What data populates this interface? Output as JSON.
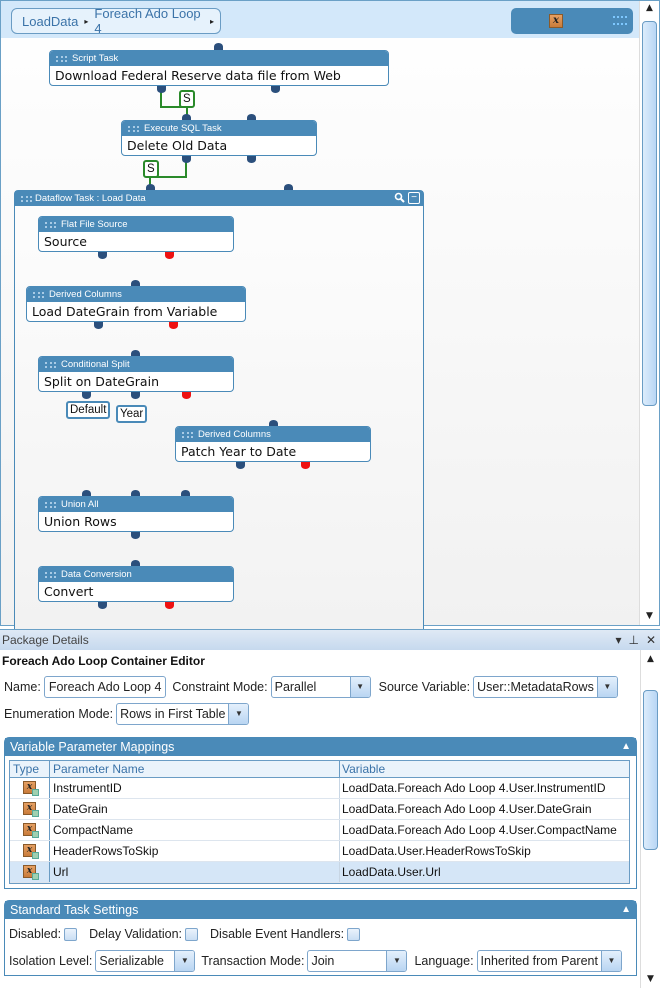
{
  "designer": {
    "breadcrumb": [
      {
        "label": "LoadData"
      },
      {
        "label": "Foreach Ado Loop 4"
      }
    ],
    "breadcrumb_separator": "▸",
    "variables_button_icon": "variable-x-icon",
    "colors": {
      "node_header": "#4a8ab8",
      "port": "#2b4f7c",
      "error_port": "#ee1111",
      "success_constraint": "#2a8a2a",
      "header_band": "#d3e8fa"
    },
    "control_flow": [
      {
        "type": "Script Task",
        "name": "Download Federal Reserve data file from Web"
      },
      {
        "type": "Execute SQL Task",
        "name": "Delete Old Data"
      }
    ],
    "constraints": [
      {
        "label": "S",
        "from": "Download Federal Reserve data file from Web",
        "to": "Delete Old Data"
      },
      {
        "label": "S",
        "from": "Delete Old Data",
        "to": "Dataflow Task : Load Data"
      }
    ],
    "dataflow": {
      "title": "Dataflow Task : Load Data",
      "zoom_icon": "magnifier-icon",
      "collapse_icon": "collapse-icon",
      "components": [
        {
          "type": "Flat File Source",
          "name": "Source"
        },
        {
          "type": "Derived Columns",
          "name": "Load DateGrain from Variable"
        },
        {
          "type": "Conditional Split",
          "name": "Split on DateGrain"
        },
        {
          "type": "Derived Columns",
          "name": "Patch Year to Date"
        },
        {
          "type": "Union All",
          "name": "Union Rows"
        },
        {
          "type": "Data Conversion",
          "name": "Convert"
        }
      ],
      "paths": [
        {
          "label": "Default"
        },
        {
          "label": "Year"
        }
      ]
    }
  },
  "details": {
    "panel_title": "Package Details",
    "title_buttons": [
      "▾",
      "⊥",
      "✕"
    ],
    "editor_heading": "Foreach Ado Loop Container Editor",
    "name_label": "Name:",
    "name_value": "Foreach Ado Loop 4",
    "constraint_mode_label": "Constraint Mode:",
    "constraint_mode_value": "Parallel",
    "source_variable_label": "Source Variable:",
    "source_variable_value": "User::MetadataRows",
    "enumeration_mode_label": "Enumeration Mode:",
    "enumeration_mode_value": "Rows in First Table",
    "mappings": {
      "title": "Variable Parameter Mappings",
      "columns": [
        "Type",
        "Parameter Name",
        "Variable"
      ],
      "rows": [
        {
          "type_icon": "variable-icon",
          "parameter": "InstrumentID",
          "variable": "LoadData.Foreach Ado Loop 4.User.InstrumentID",
          "selected": false
        },
        {
          "type_icon": "variable-icon",
          "parameter": "DateGrain",
          "variable": "LoadData.Foreach Ado Loop 4.User.DateGrain",
          "selected": false
        },
        {
          "type_icon": "variable-icon",
          "parameter": "CompactName",
          "variable": "LoadData.Foreach Ado Loop 4.User.CompactName",
          "selected": false
        },
        {
          "type_icon": "variable-icon",
          "parameter": "HeaderRowsToSkip",
          "variable": "LoadData.User.HeaderRowsToSkip",
          "selected": false
        },
        {
          "type_icon": "variable-icon",
          "parameter": "Url",
          "variable": "LoadData.User.Url",
          "selected": true
        }
      ]
    },
    "settings": {
      "title": "Standard Task Settings",
      "disabled_label": "Disabled:",
      "disabled_checked": false,
      "delay_validation_label": "Delay Validation:",
      "delay_validation_checked": false,
      "disable_event_handlers_label": "Disable Event Handlers:",
      "disable_event_handlers_checked": false,
      "isolation_level_label": "Isolation Level:",
      "isolation_level_value": "Serializable",
      "transaction_mode_label": "Transaction Mode:",
      "transaction_mode_value": "Join",
      "language_label": "Language:",
      "language_value": "Inherited from Parent"
    }
  },
  "glyphs": {
    "dropdown": "▼",
    "scroll_up": "▲",
    "scroll_down": "▼",
    "section_collapse": "▲",
    "xvar": "x",
    "zoom": "🔍",
    "collapse": "−"
  }
}
